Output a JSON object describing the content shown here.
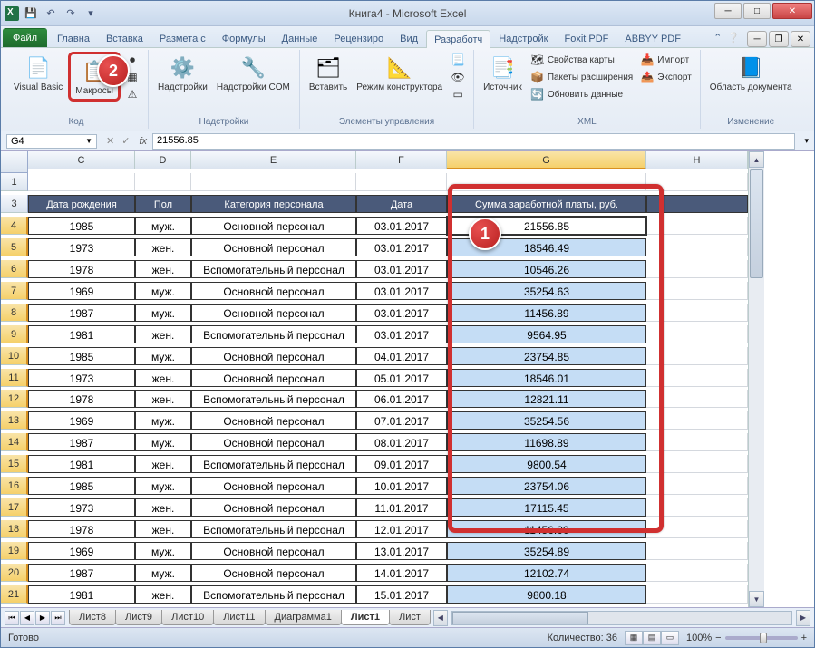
{
  "title": "Книга4 - Microsoft Excel",
  "tabs": {
    "file": "Файл",
    "list": [
      "Главна",
      "Вставка",
      "Размета с",
      "Формулы",
      "Данные",
      "Рецензиро",
      "Вид",
      "Разработч",
      "Надстройк",
      "Foxit PDF",
      "ABBYY PDF"
    ],
    "active": "Разработч"
  },
  "ribbon": {
    "groups": {
      "code": {
        "label": "Код",
        "visual_basic": "Visual Basic",
        "macros": "Макросы"
      },
      "addins": {
        "label": "Надстройки",
        "addins": "Надстройки",
        "com": "Надстройки COM"
      },
      "controls": {
        "label": "Элементы управления",
        "insert": "Вставить",
        "design": "Режим конструктора"
      },
      "xml": {
        "label": "XML",
        "source": "Источник",
        "map_props": "Свойства карты",
        "expansion": "Пакеты расширения",
        "refresh": "Обновить данные",
        "import": "Импорт",
        "export": "Экспорт"
      },
      "modify": {
        "label": "Изменение",
        "doc_panel": "Область документа"
      }
    }
  },
  "name_box": "G4",
  "formula": "21556.85",
  "columns": [
    "C",
    "D",
    "E",
    "F",
    "G",
    "H"
  ],
  "selected_col": "G",
  "headers": {
    "C": "Дата рождения",
    "D": "Пол",
    "E": "Категория персонала",
    "F": "Дата",
    "G": "Сумма заработной платы, руб."
  },
  "rows": [
    {
      "n": 1
    },
    {
      "n": 3,
      "header": true
    },
    {
      "n": 4,
      "C": "1985",
      "D": "муж.",
      "E": "Основной персонал",
      "F": "03.01.2017",
      "G": "21556.85",
      "active": true
    },
    {
      "n": 5,
      "C": "1973",
      "D": "жен.",
      "E": "Основной персонал",
      "F": "03.01.2017",
      "G": "18546.49"
    },
    {
      "n": 6,
      "C": "1978",
      "D": "жен.",
      "E": "Вспомогательный персонал",
      "F": "03.01.2017",
      "G": "10546.26"
    },
    {
      "n": 7,
      "C": "1969",
      "D": "муж.",
      "E": "Основной персонал",
      "F": "03.01.2017",
      "G": "35254.63"
    },
    {
      "n": 8,
      "C": "1987",
      "D": "муж.",
      "E": "Основной персонал",
      "F": "03.01.2017",
      "G": "11456.89"
    },
    {
      "n": 9,
      "C": "1981",
      "D": "жен.",
      "E": "Вспомогательный персонал",
      "F": "03.01.2017",
      "G": "9564.95"
    },
    {
      "n": 10,
      "C": "1985",
      "D": "муж.",
      "E": "Основной персонал",
      "F": "04.01.2017",
      "G": "23754.85"
    },
    {
      "n": 11,
      "C": "1973",
      "D": "жен.",
      "E": "Основной персонал",
      "F": "05.01.2017",
      "G": "18546.01"
    },
    {
      "n": 12,
      "C": "1978",
      "D": "жен.",
      "E": "Вспомогательный персонал",
      "F": "06.01.2017",
      "G": "12821.11"
    },
    {
      "n": 13,
      "C": "1969",
      "D": "муж.",
      "E": "Основной персонал",
      "F": "07.01.2017",
      "G": "35254.56"
    },
    {
      "n": 14,
      "C": "1987",
      "D": "муж.",
      "E": "Основной персонал",
      "F": "08.01.2017",
      "G": "11698.89"
    },
    {
      "n": 15,
      "C": "1981",
      "D": "жен.",
      "E": "Вспомогательный персонал",
      "F": "09.01.2017",
      "G": "9800.54"
    },
    {
      "n": 16,
      "C": "1985",
      "D": "муж.",
      "E": "Основной персонал",
      "F": "10.01.2017",
      "G": "23754.06"
    },
    {
      "n": 17,
      "C": "1973",
      "D": "жен.",
      "E": "Основной персонал",
      "F": "11.01.2017",
      "G": "17115.45"
    },
    {
      "n": 18,
      "C": "1978",
      "D": "жен.",
      "E": "Вспомогательный персонал",
      "F": "12.01.2017",
      "G": "11456.00"
    },
    {
      "n": 19,
      "C": "1969",
      "D": "муж.",
      "E": "Основной персонал",
      "F": "13.01.2017",
      "G": "35254.89"
    },
    {
      "n": 20,
      "C": "1987",
      "D": "муж.",
      "E": "Основной персонал",
      "F": "14.01.2017",
      "G": "12102.74"
    },
    {
      "n": 21,
      "C": "1981",
      "D": "жен.",
      "E": "Вспомогательный персонал",
      "F": "15.01.2017",
      "G": "9800.18"
    }
  ],
  "sheets": [
    "Лист8",
    "Лист9",
    "Лист10",
    "Лист11",
    "Диаграмма1",
    "Лист1",
    "Лист"
  ],
  "active_sheet": "Лист1",
  "status": {
    "ready": "Готово",
    "count_label": "Количество: 36",
    "zoom": "100%"
  },
  "callouts": {
    "1": "1",
    "2": "2"
  }
}
